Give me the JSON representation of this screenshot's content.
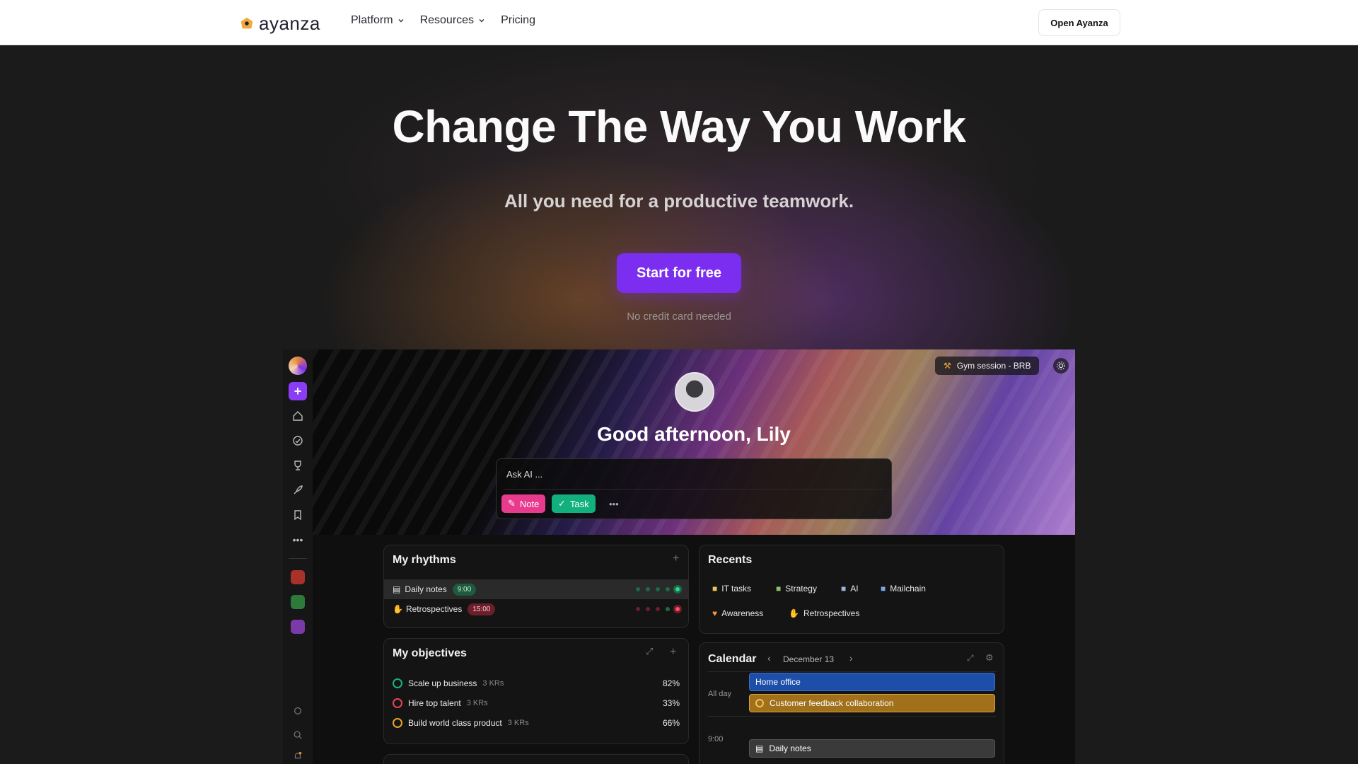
{
  "nav": {
    "brand": "ayanza",
    "links": [
      {
        "label": "Platform",
        "has_dropdown": true
      },
      {
        "label": "Resources",
        "has_dropdown": true
      },
      {
        "label": "Pricing",
        "has_dropdown": false
      }
    ],
    "open_button": "Open Ayanza"
  },
  "hero": {
    "title": "Change The Way You Work",
    "subtitle": "All you need for a productive teamwork.",
    "cta": "Start for free",
    "note": "No credit card needed"
  },
  "app": {
    "status_chip": "Gym session - BRB",
    "greeting": "Good afternoon, Lily",
    "ask_placeholder": "Ask AI ...",
    "note_button": "Note",
    "task_button": "Task",
    "more_button": "•••",
    "rhythms": {
      "title": "My rhythms",
      "items": [
        {
          "label": "Daily notes",
          "time": "9:00"
        },
        {
          "label": "Retrospectives",
          "time": "15:00"
        }
      ]
    },
    "objectives": {
      "title": "My objectives",
      "items": [
        {
          "label": "Scale up business",
          "krs": "3 KRs",
          "pct": "82%",
          "color": "#19b47c"
        },
        {
          "label": "Hire top talent",
          "krs": "3 KRs",
          "pct": "33%",
          "color": "#e6445c"
        },
        {
          "label": "Build world class product",
          "krs": "3 KRs",
          "pct": "66%",
          "color": "#e6a626"
        }
      ]
    },
    "recents": {
      "title": "Recents",
      "items": [
        "IT tasks",
        "Strategy",
        "AI",
        "Mailchain",
        "Awareness",
        "Retrospectives"
      ]
    },
    "calendar": {
      "title": "Calendar",
      "date": "December 13",
      "all_day_label": "All day",
      "time_label": "9:00",
      "events": [
        "Home office",
        "Customer feedback collaboration",
        "Daily notes"
      ]
    }
  },
  "colors": {
    "accent": "#7c2ef0",
    "note": "#e93b8d",
    "task": "#12b07c"
  }
}
